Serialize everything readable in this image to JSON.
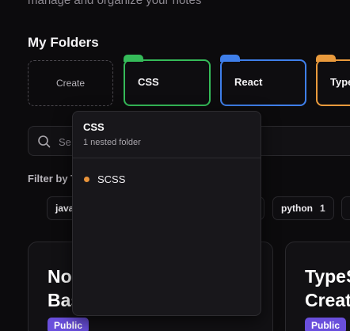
{
  "header": {
    "subtitle": "manage and organize your notes"
  },
  "folders_section": {
    "title": "My Folders",
    "create_label": "Create",
    "folders": [
      {
        "name": "CSS",
        "color": "#35bb59"
      },
      {
        "name": "React",
        "color": "#3f7fea"
      },
      {
        "name": "Type",
        "color": "#e99a3c"
      }
    ]
  },
  "search": {
    "placeholder": "Se",
    "icon": "search-icon"
  },
  "filter": {
    "label": "Filter by T",
    "tags": [
      {
        "label": "java",
        "count": ""
      },
      {
        "label": "",
        "count": ""
      },
      {
        "label": "python",
        "count": "1"
      },
      {
        "label": "",
        "count": ""
      }
    ]
  },
  "notes": [
    {
      "title_line1": "No",
      "title_line2": "Bas",
      "badge": "Public"
    },
    {
      "title_line1": "TypeS",
      "title_line2": "Creat",
      "badge": "Public"
    }
  ],
  "popover": {
    "title": "CSS",
    "subtitle": "1 nested folder",
    "items": [
      {
        "name": "SCSS",
        "color": "#e8933a"
      }
    ]
  }
}
